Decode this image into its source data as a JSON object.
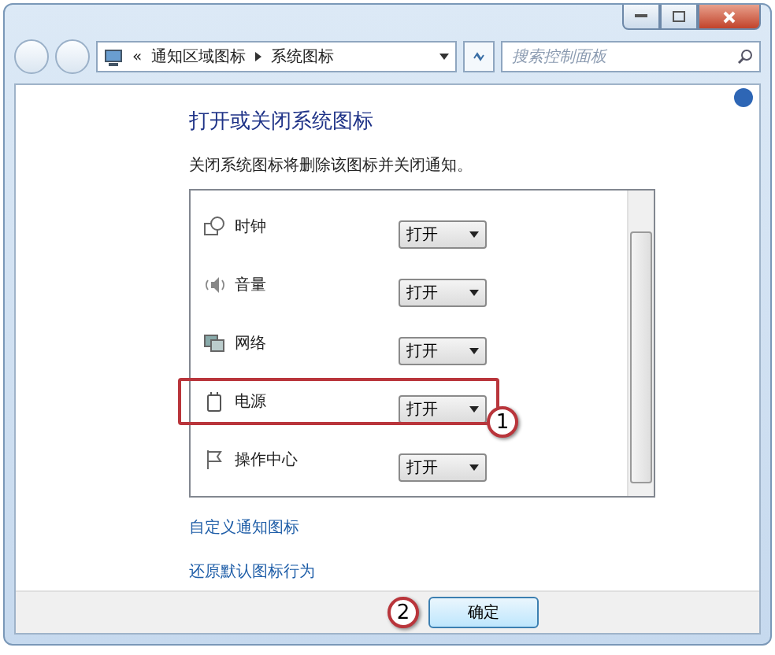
{
  "breadcrumb": {
    "overflow": "«",
    "items": [
      {
        "label": "通知区域图标"
      },
      {
        "label": "系统图标"
      }
    ]
  },
  "search": {
    "placeholder": "搜索控制面板"
  },
  "heading": "打开或关闭系统图标",
  "description": "关闭系统图标将删除该图标并关闭通知。",
  "icons": [
    {
      "kind": "clock",
      "name": "时钟",
      "value": "打开",
      "highlighted": false
    },
    {
      "kind": "volume",
      "name": "音量",
      "value": "打开",
      "highlighted": false
    },
    {
      "kind": "network",
      "name": "网络",
      "value": "打开",
      "highlighted": false
    },
    {
      "kind": "power",
      "name": "电源",
      "value": "打开",
      "highlighted": true,
      "callout": "1"
    },
    {
      "kind": "flag",
      "name": "操作中心",
      "value": "打开",
      "highlighted": false
    }
  ],
  "links": [
    "自定义通知图标",
    "还原默认图标行为"
  ],
  "ok_button": {
    "label": "确定",
    "callout": "2"
  }
}
